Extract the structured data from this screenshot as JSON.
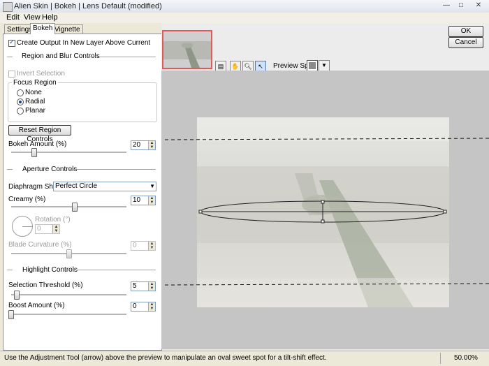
{
  "window": {
    "title": "Alien Skin | Bokeh | Lens Default (modified)",
    "min_glyph": "—",
    "max_glyph": "□",
    "close_glyph": "✕"
  },
  "menu": [
    "Edit",
    "View",
    "Help"
  ],
  "tabs": [
    "Settings",
    "Bokeh",
    "Vignette"
  ],
  "options": {
    "create_output_label": "Create Output In New Layer Above Current",
    "create_output_checked": true
  },
  "region": {
    "header": "Region and Blur Controls",
    "invert_label": "Invert Selection",
    "focus_region_label": "Focus Region",
    "focus_options": [
      "None",
      "Radial",
      "Planar"
    ],
    "focus_selected": "Radial",
    "reset_button": "Reset Region Controls",
    "bokeh_amount_label": "Bokeh Amount (%)",
    "bokeh_amount_value": "20",
    "bokeh_amount_level": 0.2
  },
  "aperture": {
    "header": "Aperture Controls",
    "shape_label": "Diaphragm Shape:",
    "shape_value": "Perfect Circle",
    "creamy_label": "Creamy (%)",
    "creamy_value": "10",
    "creamy_level": 0.55,
    "rotation_label": "Rotation (°)",
    "rotation_value": "0",
    "blade_label": "Blade Curvature (%)",
    "blade_value": "0",
    "blade_level": 0.5
  },
  "highlight": {
    "header": "Highlight Controls",
    "threshold_label": "Selection Threshold (%)",
    "threshold_value": "5",
    "threshold_level": 0.05,
    "boost_label": "Boost Amount (%)",
    "boost_value": "0",
    "boost_level": 0.0
  },
  "buttons": {
    "ok": "OK",
    "cancel": "Cancel"
  },
  "preview": {
    "split_label": "Preview Split:"
  },
  "status": {
    "message": "Use the Adjustment Tool (arrow) above the preview to manipulate an oval sweet spot for a tilt-shift effect.",
    "zoom": "50.00%"
  },
  "colors": {
    "accent": "#e05a5a",
    "panel": "#ece9d8",
    "preview_bg": "#c5c5c5"
  }
}
